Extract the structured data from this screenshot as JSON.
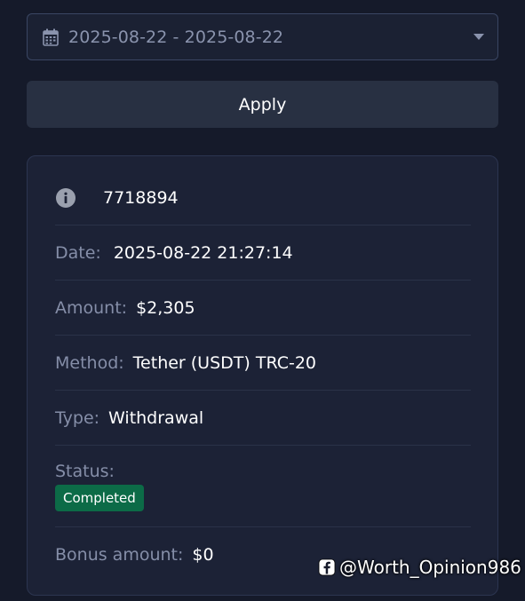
{
  "filter": {
    "date_range": "2025-08-22 - 2025-08-22",
    "calendar_icon": "calendar-icon",
    "dropdown_icon": "caret-down-icon"
  },
  "apply_label": "Apply",
  "transaction": {
    "id": "7718894",
    "date_label": "Date:",
    "date_value": "2025-08-22 21:27:14",
    "amount_label": "Amount:",
    "amount_value": "$2,305",
    "method_label": "Method:",
    "method_value": "Tether (USDT) TRC-20",
    "type_label": "Type:",
    "type_value": "Withdrawal",
    "status_label": "Status:",
    "status_value": "Completed",
    "bonus_label": "Bonus amount:",
    "bonus_value": "$0"
  },
  "watermark": "@Worth_Opinion986",
  "colors": {
    "background": "#151a2a",
    "card": "#1c2236",
    "button": "#283042",
    "status_completed": "#0c6b47",
    "label": "#858ea8"
  }
}
